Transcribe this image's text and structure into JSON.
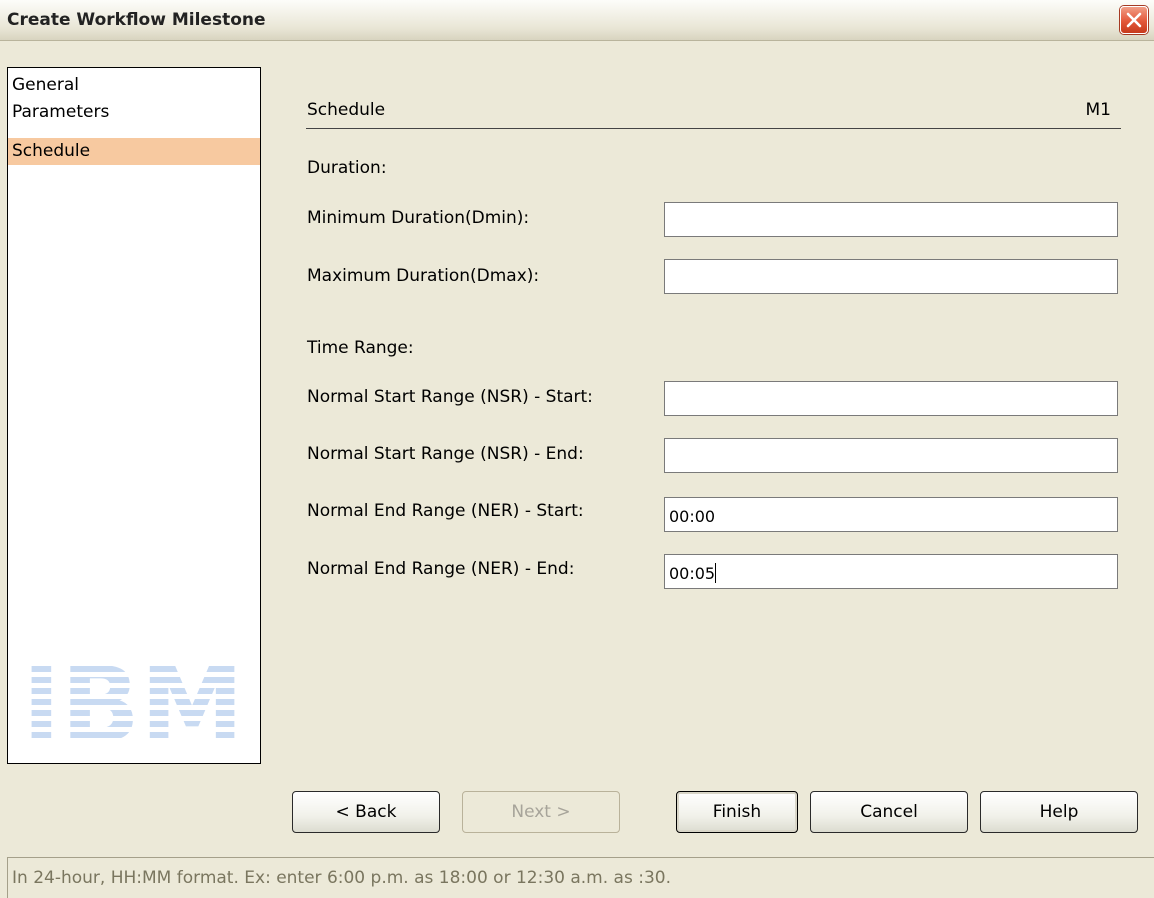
{
  "window": {
    "title": "Create Workflow Milestone"
  },
  "nav": {
    "items": [
      {
        "label": "General",
        "selected": false
      },
      {
        "label": "Parameters",
        "selected": false
      },
      {
        "label": "Schedule",
        "selected": true
      }
    ],
    "logo": "IBM"
  },
  "content": {
    "section_title": "Schedule",
    "milestone_id": "M1",
    "duration_heading": "Duration:",
    "time_range_heading": "Time Range:",
    "fields": {
      "min_duration": {
        "label": "Minimum Duration(Dmin):",
        "value": ""
      },
      "max_duration": {
        "label": "Maximum Duration(Dmax):",
        "value": ""
      },
      "nsr_start": {
        "label": "Normal Start Range (NSR) - Start:",
        "value": ""
      },
      "nsr_end": {
        "label": "Normal Start Range (NSR) - End:",
        "value": ""
      },
      "ner_start": {
        "label": "Normal End Range (NER) - Start:",
        "value": "00:00"
      },
      "ner_end": {
        "label": "Normal End Range (NER) - End:",
        "value": "00:05"
      }
    }
  },
  "buttons": {
    "back": "< Back",
    "next": "Next >",
    "finish": "Finish",
    "cancel": "Cancel",
    "help": "Help"
  },
  "status": "In 24-hour, HH:MM format. Ex: enter 6:00 p.m. as 18:00 or 12:30 a.m. as :30.",
  "colors": {
    "window_bg": "#ece9d8",
    "selected_item": "#f7c9a0",
    "close_button": "#e3583a",
    "status_text": "#7a765f"
  }
}
